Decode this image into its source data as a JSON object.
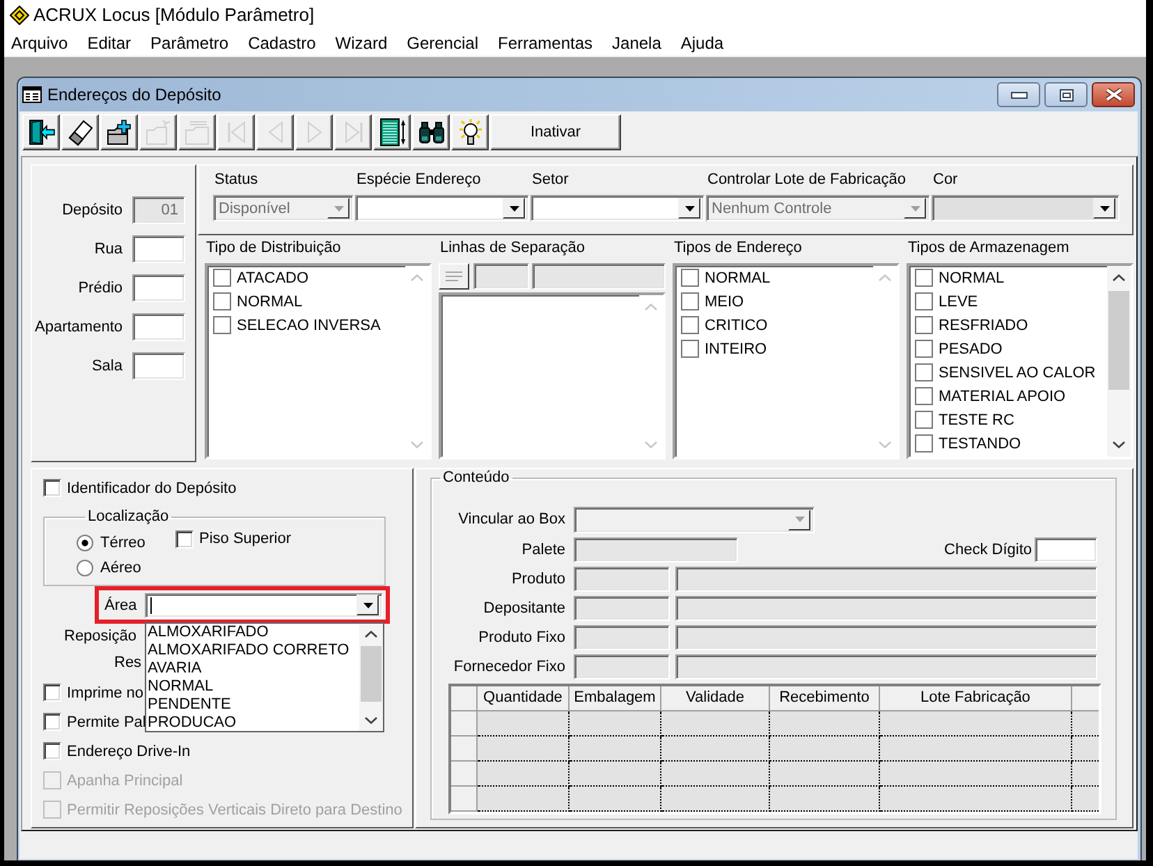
{
  "app": {
    "title": "ACRUX Locus [Módulo Parâmetro]"
  },
  "menu": [
    "Arquivo",
    "Editar",
    "Parâmetro",
    "Cadastro",
    "Wizard",
    "Gerencial",
    "Ferramentas",
    "Janela",
    "Ajuda"
  ],
  "window": {
    "title": "Endereços do Depósito"
  },
  "toolbar": {
    "buttons": [
      {
        "kind": "exit",
        "disabled": false
      },
      {
        "kind": "erase",
        "disabled": false
      },
      {
        "kind": "add",
        "disabled": false
      },
      {
        "kind": "edit",
        "disabled": true
      },
      {
        "kind": "remove",
        "disabled": true
      },
      {
        "kind": "first",
        "disabled": true
      },
      {
        "kind": "previous",
        "disabled": true
      },
      {
        "kind": "next",
        "disabled": true
      },
      {
        "kind": "last",
        "disabled": true
      },
      {
        "kind": "grid",
        "disabled": false
      },
      {
        "kind": "search",
        "disabled": false
      },
      {
        "kind": "hint",
        "disabled": false
      },
      {
        "kind": "text",
        "label": "Inativar",
        "disabled": false
      }
    ]
  },
  "address": [
    {
      "label": "Depósito",
      "value": "01",
      "disabled": true
    },
    {
      "label": "Rua",
      "disabled": false
    },
    {
      "label": "Prédio",
      "disabled": false
    },
    {
      "label": "Apartamento",
      "disabled": false
    },
    {
      "label": "Sala",
      "disabled": false
    }
  ],
  "selectors": [
    {
      "label": "Status",
      "kind": "text",
      "value": "Disponível",
      "disabled": true
    },
    {
      "label": "Espécie Endereço",
      "kind": "text",
      "disabled": false
    },
    {
      "label": "Setor",
      "kind": "text",
      "disabled": false
    },
    {
      "label": "Controlar Lote de Fabricação",
      "kind": "text",
      "value": "Nenhum Controle",
      "disabled": true
    },
    {
      "label": "Cor",
      "kind": "color",
      "disabled": false
    }
  ],
  "lists": [
    {
      "title": "Tipo de Distribuição",
      "kind": "checklist",
      "scrollable": false,
      "items": [
        {
          "label": "ATACADO",
          "checked": false
        },
        {
          "label": "NORMAL",
          "checked": false
        },
        {
          "label": "SELECAO INVERSA",
          "checked": false
        }
      ]
    },
    {
      "title": "Linhas de Separação",
      "kind": "editor",
      "scrollable": false
    },
    {
      "title": "Tipos de Endereço",
      "kind": "checklist",
      "scrollable": false,
      "items": [
        {
          "label": "NORMAL",
          "checked": false
        },
        {
          "label": "MEIO",
          "checked": false
        },
        {
          "label": "CRITICO",
          "checked": false
        },
        {
          "label": "INTEIRO",
          "checked": false
        }
      ]
    },
    {
      "title": "Tipos de Armazenagem",
      "kind": "checklist",
      "scrollable": true,
      "items": [
        {
          "label": "NORMAL",
          "checked": false
        },
        {
          "label": "LEVE",
          "checked": false
        },
        {
          "label": "RESFRIADO",
          "checked": false
        },
        {
          "label": "PESADO",
          "checked": false
        },
        {
          "label": "SENSIVEL AO CALOR",
          "checked": false
        },
        {
          "label": "MATERIAL APOIO",
          "checked": false
        },
        {
          "label": "TESTE RC",
          "checked": false
        },
        {
          "label": "TESTANDO",
          "checked": false
        }
      ]
    }
  ],
  "options": {
    "identifier": {
      "label": "Identificador do Depósito",
      "checked": false
    },
    "location": {
      "title": "Localização",
      "levels": [
        {
          "label": "Térreo",
          "selected": true
        },
        {
          "label": "Aéreo",
          "selected": false
        }
      ],
      "upper_floor": {
        "label": "Piso Superior",
        "checked": false
      }
    },
    "area": {
      "label": "Área",
      "highlighted": true,
      "open": true,
      "options": [
        {
          "label": "ALMOXARIFADO",
          "selected": false
        },
        {
          "label": "ALMOXARIFADO CORRETO",
          "selected": false
        },
        {
          "label": "AVARIA",
          "selected": false
        },
        {
          "label": "NORMAL",
          "selected": false
        },
        {
          "label": "PENDENTE",
          "selected": false
        },
        {
          "label": "PRODUCAO",
          "selected": false
        }
      ]
    },
    "covered_labels": [
      "Reposição",
      "Res"
    ],
    "checks": [
      {
        "label": "Imprime no",
        "checked": false,
        "disabled": false
      },
      {
        "label": "Permite Pal",
        "checked": false,
        "disabled": false
      },
      {
        "label": "Endereço Drive-In",
        "checked": false,
        "disabled": false
      },
      {
        "label": "Apanha Principal",
        "checked": false,
        "disabled": true
      },
      {
        "label": "Permitir Reposições Verticais Direto para Destino",
        "checked": false,
        "disabled": true
      }
    ]
  },
  "content": {
    "title": "Conteúdo",
    "box": {
      "label": "Vincular ao Box",
      "disabled": true
    },
    "pallet": {
      "label": "Palete",
      "disabled": true
    },
    "check_digit": {
      "label": "Check Dígito",
      "disabled": false
    },
    "lookups": [
      {
        "label": "Produto",
        "disabled": true
      },
      {
        "label": "Depositante",
        "disabled": true
      },
      {
        "label": "Produto Fixo",
        "disabled": true
      },
      {
        "label": "Fornecedor Fixo",
        "disabled": true
      }
    ],
    "grid": {
      "columns": [
        "Quantidade",
        "Embalagem",
        "Validade",
        "Recebimento",
        "Lote Fabricação"
      ]
    }
  }
}
